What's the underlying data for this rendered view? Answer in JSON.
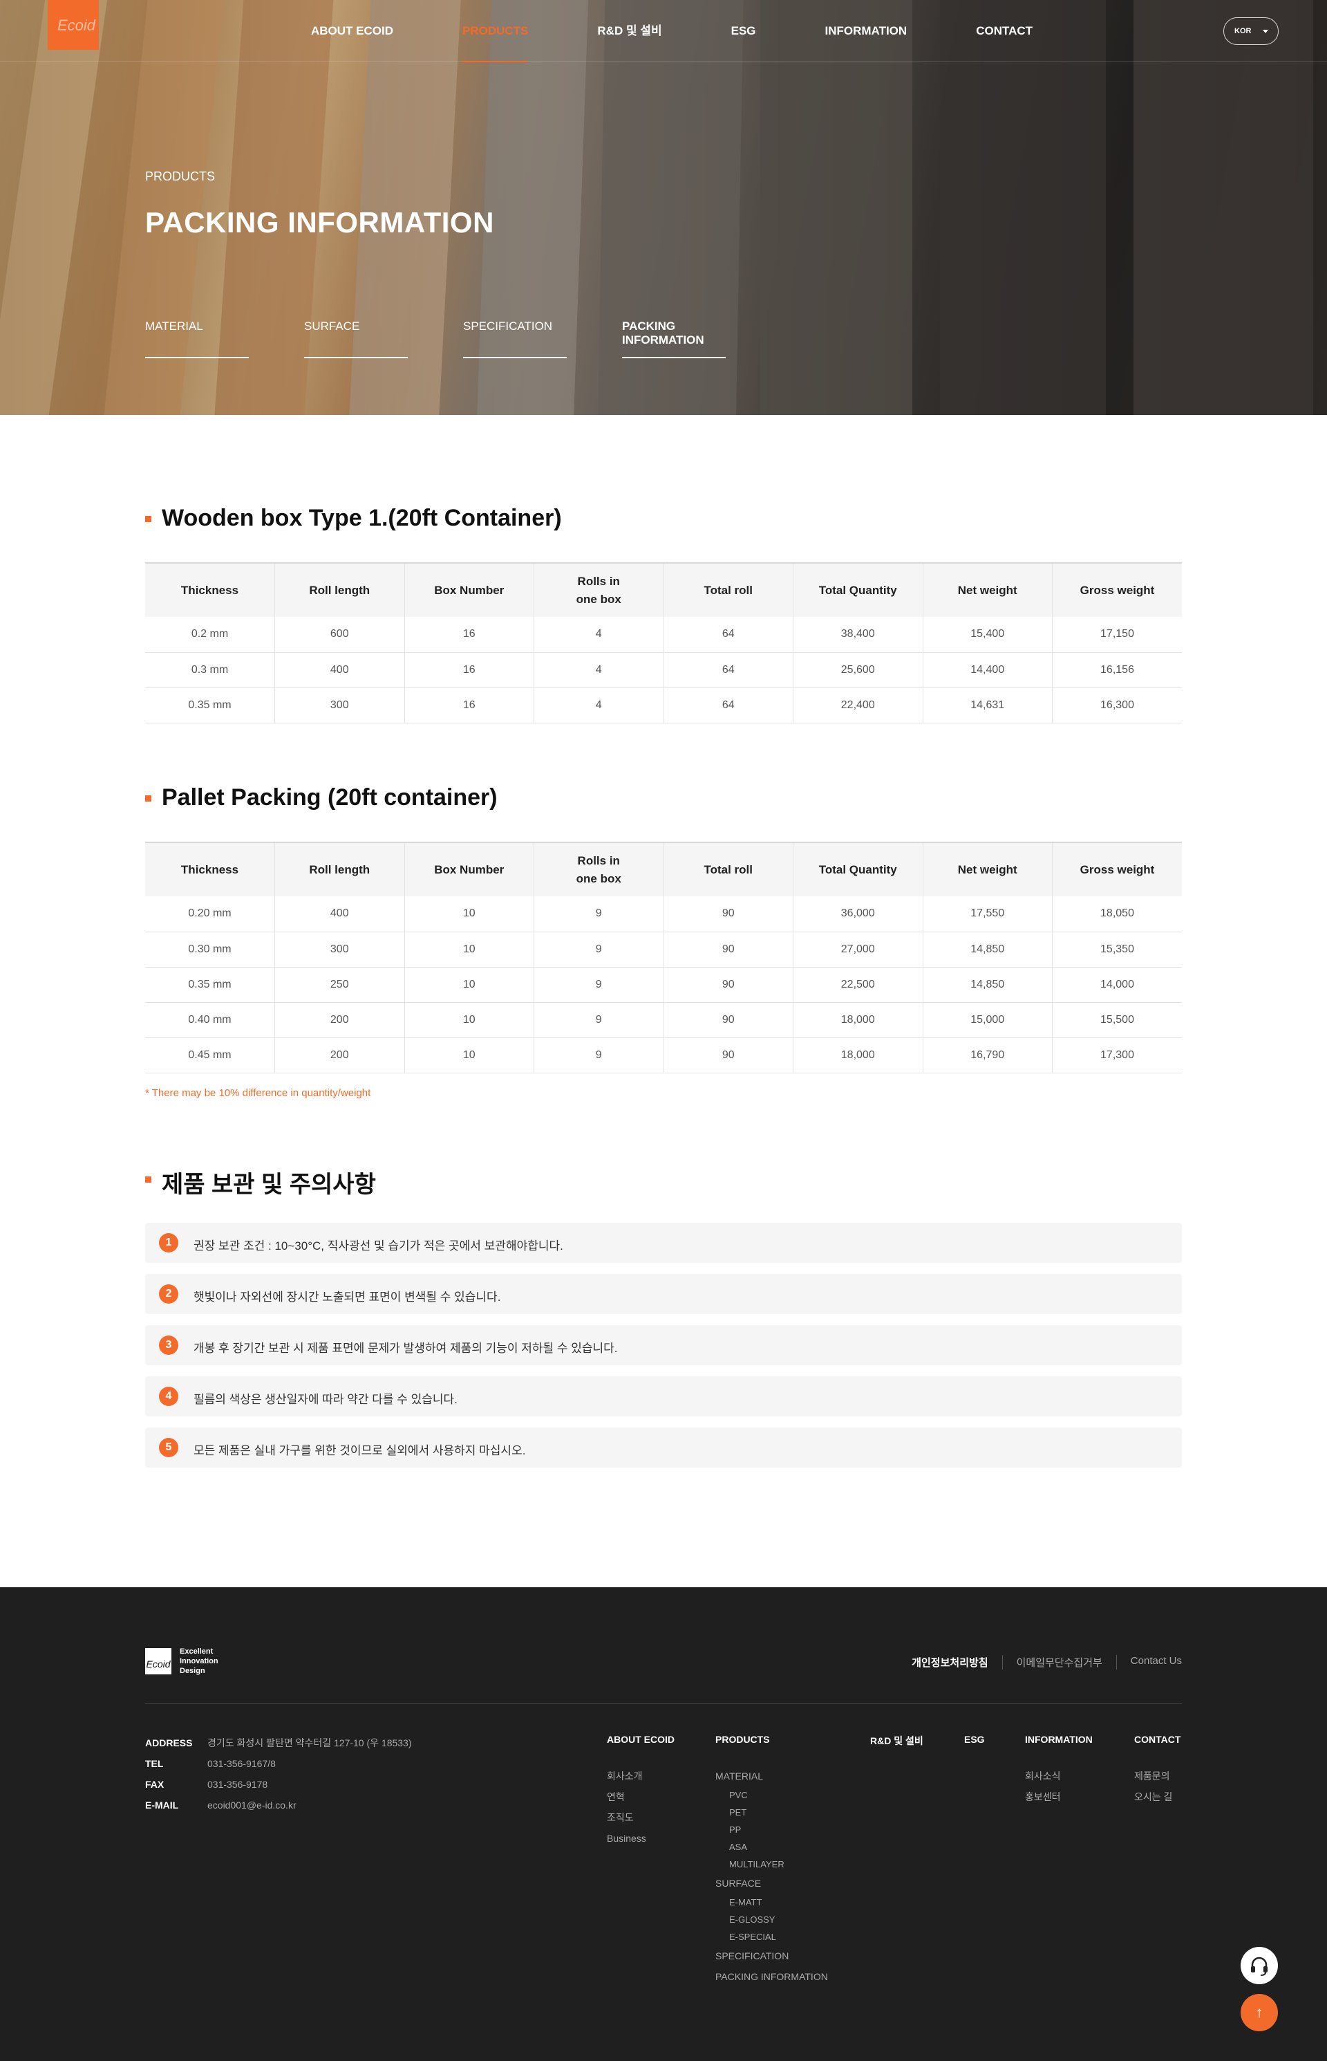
{
  "header": {
    "nav": [
      "ABOUT ECOID",
      "PRODUCTS",
      "R&D 및 설비",
      "ESG",
      "INFORMATION",
      "CONTACT"
    ],
    "active_nav": "PRODUCTS",
    "lang": "KOR"
  },
  "hero": {
    "category": "PRODUCTS",
    "title": "PACKING INFORMATION",
    "tabs": [
      "MATERIAL",
      "SURFACE",
      "SPECIFICATION",
      "PACKING INFORMATION"
    ],
    "active_tab": "PACKING INFORMATION"
  },
  "columns": [
    "Thickness",
    "Roll length",
    "Box Number",
    "Rolls in\none box",
    "Total roll",
    "Total Quantity",
    "Net weight",
    "Gross weight"
  ],
  "wooden": {
    "title": "Wooden box Type 1.(20ft Container)",
    "rows": [
      [
        "0.2 mm",
        "600",
        "16",
        "4",
        "64",
        "38,400",
        "15,400",
        "17,150"
      ],
      [
        "0.3 mm",
        "400",
        "16",
        "4",
        "64",
        "25,600",
        "14,400",
        "16,156"
      ],
      [
        "0.35 mm",
        "300",
        "16",
        "4",
        "64",
        "22,400",
        "14,631",
        "16,300"
      ]
    ]
  },
  "pallet": {
    "title": "Pallet Packing (20ft container)",
    "rows": [
      [
        "0.20 mm",
        "400",
        "10",
        "9",
        "90",
        "36,000",
        "17,550",
        "18,050"
      ],
      [
        "0.30 mm",
        "300",
        "10",
        "9",
        "90",
        "27,000",
        "14,850",
        "15,350"
      ],
      [
        "0.35 mm",
        "250",
        "10",
        "9",
        "90",
        "22,500",
        "14,850",
        "14,000"
      ],
      [
        "0.40 mm",
        "200",
        "10",
        "9",
        "90",
        "18,000",
        "15,000",
        "15,500"
      ],
      [
        "0.45 mm",
        "200",
        "10",
        "9",
        "90",
        "18,000",
        "16,790",
        "17,300"
      ]
    ],
    "note": "* There may be 10% difference in quantity/weight"
  },
  "storage": {
    "title": "제품 보관 및 주의사항",
    "items": [
      {
        "num": "1",
        "text": "권장 보관 조건 : 10~30°C, 직사광선 및 습기가 적은 곳에서 보관해야합니다."
      },
      {
        "num": "2",
        "text": "햇빛이나 자외선에 장시간 노출되면 표면이 변색될 수 있습니다."
      },
      {
        "num": "3",
        "text": "개봉 후 장기간 보관 시 제품 표면에 문제가 발생하여 제품의 기능이 저하될 수 있습니다."
      },
      {
        "num": "4",
        "text": "필름의 색상은 생산일자에 따라 약간 다를 수 있습니다."
      },
      {
        "num": "5",
        "text": "모든 제품은 실내 가구를 위한 것이므로 실외에서 사용하지 마십시오."
      }
    ]
  },
  "footer": {
    "logo_mark": "Ecoid",
    "logo_text": [
      "Excellent",
      "Innovation",
      "Design"
    ],
    "links": [
      "개인정보처리방침",
      "이메일무단수집거부",
      "Contact Us"
    ],
    "info": [
      {
        "k": "ADDRESS",
        "v": "경기도 화성시 팔탄면 약수터길 127-10 (우 18533)"
      },
      {
        "k": "TEL",
        "v": "031-356-9167/8"
      },
      {
        "k": "FAX",
        "v": "031-356-9178"
      },
      {
        "k": "E-MAIL",
        "v": "ecoid001@e-id.co.kr"
      }
    ],
    "sitemap": {
      "about": {
        "head": "ABOUT ECOID",
        "items": [
          "회사소개",
          "연혁",
          "조직도",
          "Business"
        ]
      },
      "products": {
        "head": "PRODUCTS",
        "material": "MATERIAL",
        "material_items": [
          "PVC",
          "PET",
          "PP",
          "ASA",
          "MULTILAYER"
        ],
        "surface": "SURFACE",
        "surface_items": [
          "E-MATT",
          "E-GLOSSY",
          "E-SPECIAL"
        ],
        "spec": "SPECIFICATION",
        "packing": "PACKING INFORMATION"
      },
      "rnd": {
        "head": "R&D 및 설비"
      },
      "esg": {
        "head": "ESG"
      },
      "information": {
        "head": "INFORMATION",
        "items": [
          "회사소식",
          "홍보센터"
        ]
      },
      "contact": {
        "head": "CONTACT",
        "items": [
          "제품문의",
          "오시는 길"
        ]
      }
    }
  },
  "colors": {
    "accent": "#f26b2a",
    "footer_bg": "#1f1f1f"
  },
  "icons": {
    "cs": "headset-icon",
    "top": "arrow-up-icon"
  }
}
